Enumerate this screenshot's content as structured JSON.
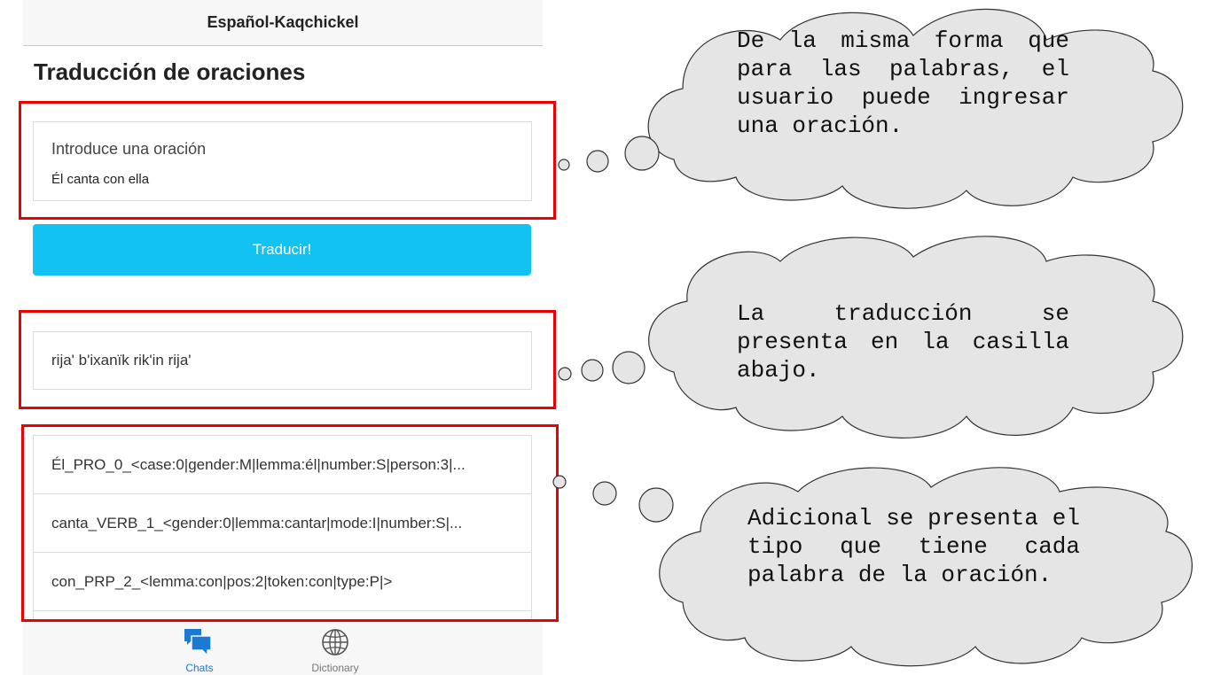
{
  "app": {
    "nav_title": "Español-Kaqchickel",
    "page_title": "Traducción de oraciones",
    "input": {
      "label": "Introduce una oración",
      "value": "Él canta con ella"
    },
    "translate_button": "Traducir!",
    "translation": "rija' b'ixanïk rik'in rija'",
    "tokens": [
      "Él_PRO_0_<case:0|gender:M|lemma:él|number:S|person:3|...",
      "canta_VERB_1_<gender:0|lemma:cantar|mode:I|number:S|...",
      "con_PRP_2_<lemma:con|pos:2|token:con|type:P|>"
    ],
    "tabs": {
      "chats": "Chats",
      "dictionary": "Dictionary"
    },
    "colors": {
      "accent": "#12c2f3",
      "highlight": "#ee0000",
      "tab_active": "#1a7ad6"
    }
  },
  "annotations": {
    "cloud1": "De la misma forma que para las palabras, el usuario puede ingresar una oración.",
    "cloud2": "La traducción se presenta en la casilla abajo.",
    "cloud3": "Adicional se presenta el tipo que tiene cada palabra de la oración."
  }
}
